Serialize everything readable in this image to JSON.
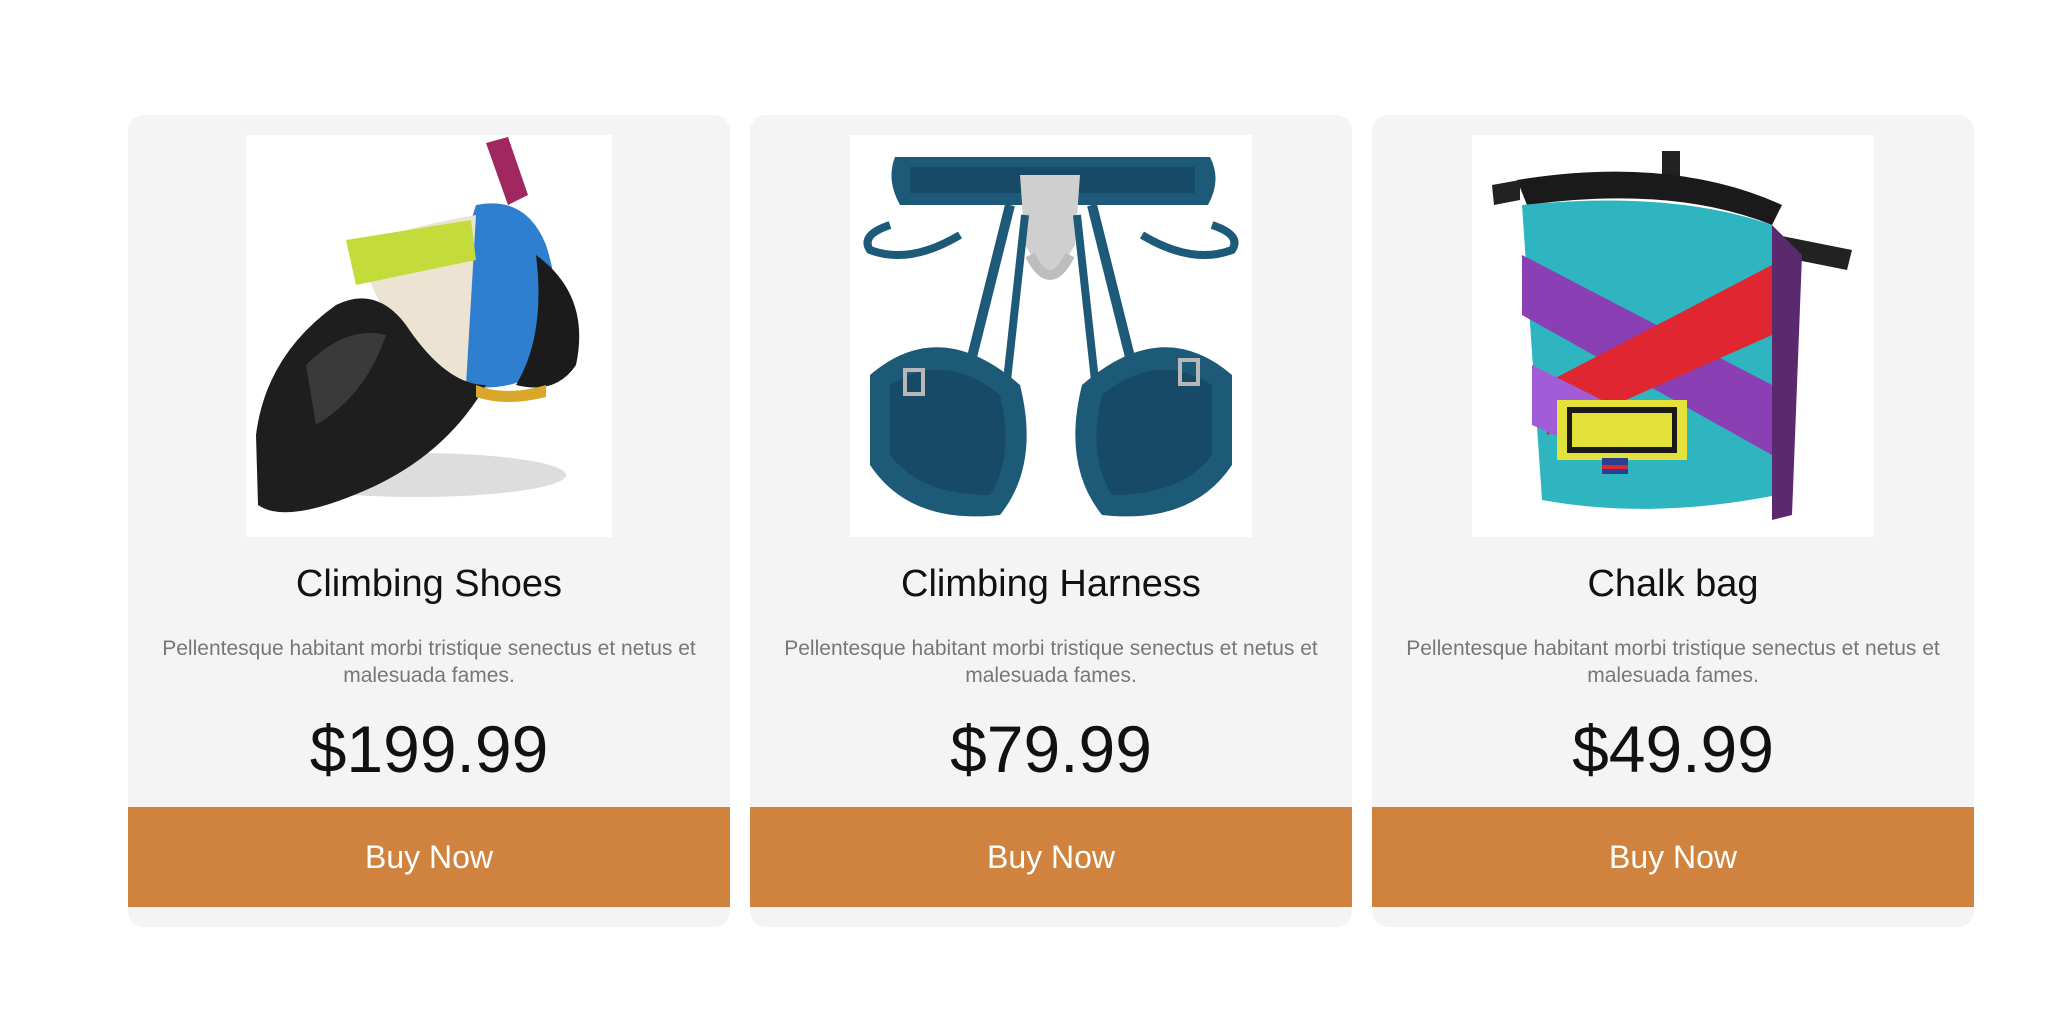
{
  "products": [
    {
      "image_icon": "climbing-shoe-image",
      "title": "Climbing Shoes",
      "description": "Pellentesque habitant morbi tristique senectus et netus et malesuada fames.",
      "price": "$199.99",
      "button_label": "Buy Now"
    },
    {
      "image_icon": "climbing-harness-image",
      "title": "Climbing Harness",
      "description": "Pellentesque habitant morbi tristique senectus et netus et malesuada fames.",
      "price": "$79.99",
      "button_label": "Buy Now"
    },
    {
      "image_icon": "chalk-bag-image",
      "title": "Chalk bag",
      "description": "Pellentesque habitant morbi tristique senectus et netus et malesuada fames.",
      "price": "$49.99",
      "button_label": "Buy Now"
    }
  ],
  "colors": {
    "card_background": "#f4f4f4",
    "button_background": "#cf833e",
    "button_text": "#ffffff",
    "description_text": "#777777",
    "title_text": "#111111"
  }
}
